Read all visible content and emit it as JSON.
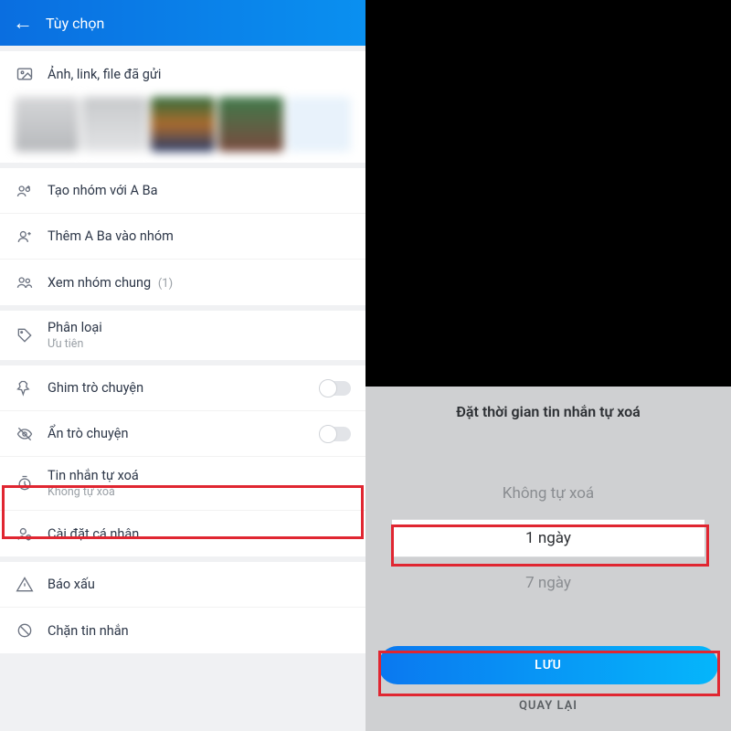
{
  "header": {
    "title": "Tùy chọn"
  },
  "files_section": {
    "label": "Ảnh, link, file đã gửi"
  },
  "group_section": {
    "create_group": "Tạo nhóm với A Ba",
    "add_to_group": "Thêm A Ba vào nhóm",
    "view_shared": "Xem nhóm chung",
    "shared_count": "(1)"
  },
  "classify": {
    "label": "Phân loại",
    "value": "Ưu tiên"
  },
  "pin": {
    "label": "Ghim trò chuyện"
  },
  "hide": {
    "label": "Ẩn trò chuyện"
  },
  "auto_delete": {
    "label": "Tin nhắn tự xoá",
    "value": "Không tự xoá"
  },
  "personal": {
    "label": "Cài đặt cá nhân"
  },
  "report": {
    "label": "Báo xấu"
  },
  "block": {
    "label": "Chặn tin nhắn"
  },
  "modal": {
    "title": "Đặt thời gian tin nhắn tự xoá",
    "option_none": "Không tự xoá",
    "option_1day": "1 ngày",
    "option_7day": "7 ngày",
    "save": "LƯU",
    "cancel": "QUAY LẠI"
  }
}
